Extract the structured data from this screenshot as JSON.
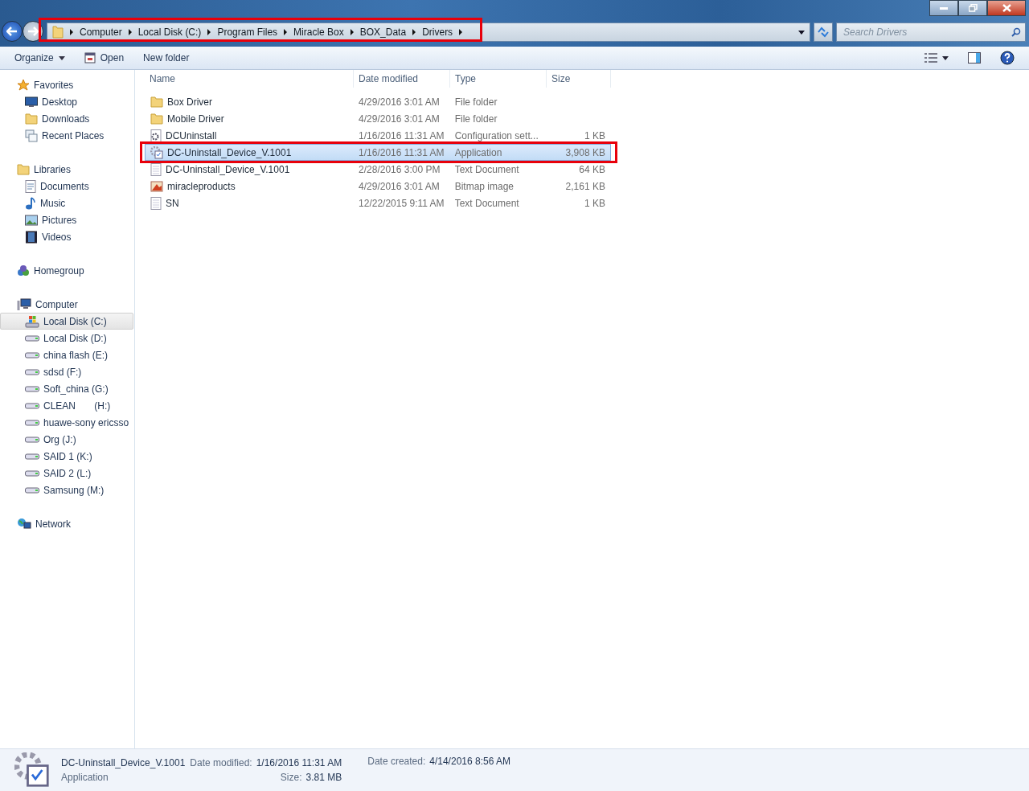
{
  "breadcrumb": {
    "highlighted": true,
    "segments": [
      "Computer",
      "Local Disk (C:)",
      "Program Files",
      "Miracle Box",
      "BOX_Data",
      "Drivers"
    ]
  },
  "search": {
    "placeholder": "Search Drivers"
  },
  "toolbar": {
    "organize": "Organize",
    "open": "Open",
    "new_folder": "New folder"
  },
  "sidebar": {
    "groups": [
      {
        "label": "Favorites",
        "kind": "star",
        "items": [
          {
            "label": "Desktop",
            "kind": "desktop",
            "selected": false
          },
          {
            "label": "Downloads",
            "kind": "folder",
            "selected": false
          },
          {
            "label": "Recent Places",
            "kind": "recent",
            "selected": false
          }
        ]
      },
      {
        "label": "Libraries",
        "kind": "library",
        "items": [
          {
            "label": "Documents",
            "kind": "document",
            "selected": false
          },
          {
            "label": "Music",
            "kind": "music",
            "selected": false
          },
          {
            "label": "Pictures",
            "kind": "pictures",
            "selected": false
          },
          {
            "label": "Videos",
            "kind": "videos",
            "selected": false
          }
        ]
      },
      {
        "label": "Homegroup",
        "kind": "homegroup"
      },
      {
        "label": "Computer",
        "kind": "computer",
        "items": [
          {
            "label": "Local Disk (C:)",
            "kind": "system-drive",
            "selected": true
          },
          {
            "label": "Local Disk (D:)",
            "kind": "drive",
            "selected": false
          },
          {
            "label": "china flash (E:)",
            "kind": "drive",
            "selected": false
          },
          {
            "label": "sdsd (F:)",
            "kind": "drive",
            "selected": false
          },
          {
            "label": "Soft_china (G:)",
            "kind": "drive",
            "selected": false
          },
          {
            "label": "CLEAN       (H:)",
            "kind": "drive",
            "selected": false
          },
          {
            "label": "huawe-sony ericsso",
            "kind": "drive",
            "selected": false
          },
          {
            "label": "Org (J:)",
            "kind": "drive",
            "selected": false
          },
          {
            "label": "SAID 1 (K:)",
            "kind": "drive",
            "selected": false
          },
          {
            "label": "SAID 2 (L:)",
            "kind": "drive",
            "selected": false
          },
          {
            "label": "Samsung (M:)",
            "kind": "drive",
            "selected": false
          }
        ]
      },
      {
        "label": "Network",
        "kind": "network"
      }
    ]
  },
  "table": {
    "columns": [
      "Name",
      "Date modified",
      "Type",
      "Size"
    ],
    "rows": [
      {
        "kind": "folder",
        "name": "Box Driver",
        "date": "4/29/2016 3:01 AM",
        "type": "File folder",
        "size": "",
        "selected": false,
        "highlighted": false
      },
      {
        "kind": "folder",
        "name": "Mobile Driver",
        "date": "4/29/2016 3:01 AM",
        "type": "File folder",
        "size": "",
        "selected": false,
        "highlighted": false
      },
      {
        "kind": "config",
        "name": "DCUninstall",
        "date": "1/16/2016 11:31 AM",
        "type": "Configuration sett...",
        "size": "1 KB",
        "selected": false,
        "highlighted": false
      },
      {
        "kind": "app",
        "name": "DC-Uninstall_Device_V.1001",
        "date": "1/16/2016 11:31 AM",
        "type": "Application",
        "size": "3,908 KB",
        "selected": true,
        "highlighted": true
      },
      {
        "kind": "text",
        "name": "DC-Uninstall_Device_V.1001",
        "date": "2/28/2016 3:00 PM",
        "type": "Text Document",
        "size": "64 KB",
        "selected": false,
        "highlighted": false
      },
      {
        "kind": "bitmap",
        "name": "miracleproducts",
        "date": "4/29/2016 3:01 AM",
        "type": "Bitmap image",
        "size": "2,161 KB",
        "selected": false,
        "highlighted": false
      },
      {
        "kind": "text",
        "name": "SN",
        "date": "12/22/2015 9:11 AM",
        "type": "Text Document",
        "size": "1 KB",
        "selected": false,
        "highlighted": false
      }
    ]
  },
  "details": {
    "name": "DC-Uninstall_Device_V.1001",
    "type": "Application",
    "fields": [
      {
        "label": "Date modified:",
        "value": "1/16/2016 11:31 AM"
      },
      {
        "label": "Size:",
        "value": "3.81 MB"
      },
      {
        "label": "Date created:",
        "value": "4/14/2016 8:56 AM"
      }
    ]
  }
}
